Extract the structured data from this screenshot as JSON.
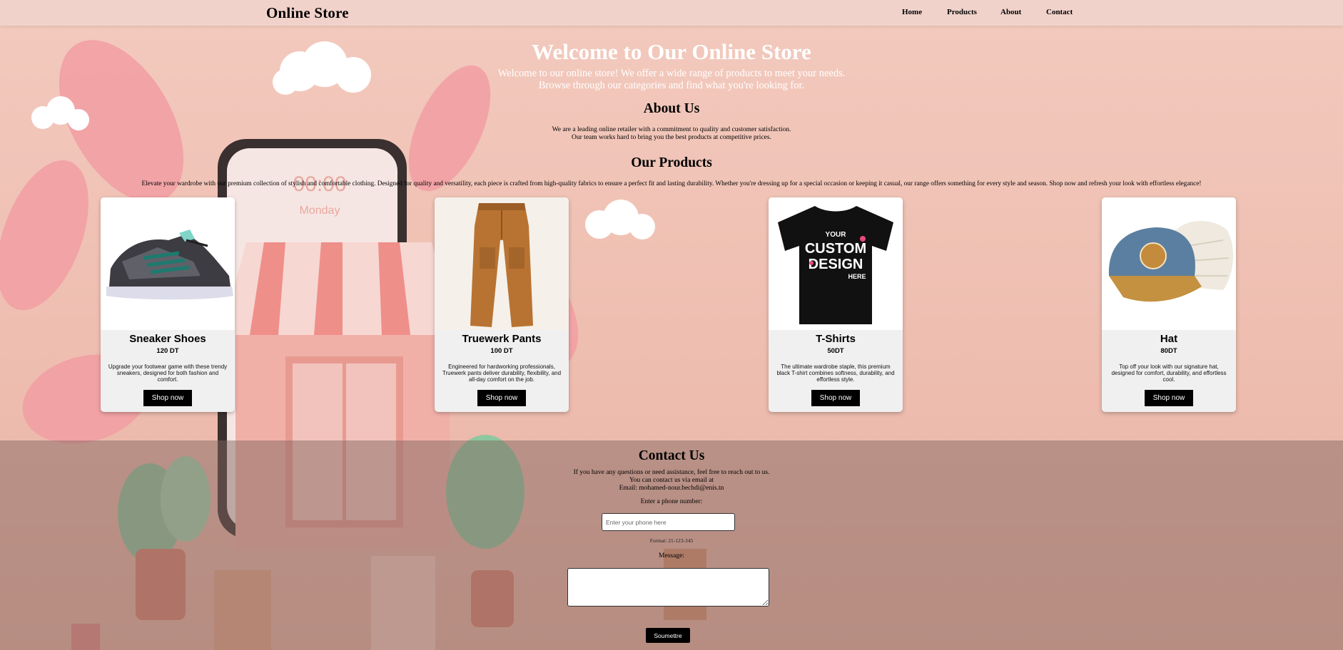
{
  "header": {
    "brand": "Online Store",
    "nav": [
      "Home",
      "Products",
      "About",
      "Contact"
    ]
  },
  "hero": {
    "title": "Welcome to Our Online Store",
    "line1": "Welcome to our online store! We offer a wide range of products to meet your needs.",
    "line2": "Browse through our categories and find what you're looking for."
  },
  "about": {
    "title": "About Us",
    "line1": "We are a leading online retailer with a commitment to quality and customer satisfaction.",
    "line2": "Our team works hard to bring you the best products at competitive prices."
  },
  "products": {
    "title": "Our Products",
    "intro": "Elevate your wardrobe with our premium collection of stylish and comfortable clothing. Designed for quality and versatility, each piece is crafted from high-quality fabrics to ensure a perfect fit and lasting durability. Whether you're dressing up for a special occasion or keeping it casual, our range offers something for every style and season. Shop now and refresh your look with effortless elegance!",
    "items": [
      {
        "name": "Sneaker Shoes",
        "price": "120 DT",
        "description": "Upgrade your footwear game with these trendy sneakers, designed for both fashion and comfort.",
        "button": "Shop now",
        "icon": "sneaker-icon"
      },
      {
        "name": "Truewerk Pants",
        "price": "100 DT",
        "description": "Engineered for hardworking professionals, Truewerk pants deliver durability, flexibility, and all-day comfort on the job.",
        "button": "Shop now",
        "icon": "pants-icon"
      },
      {
        "name": "T-Shirts",
        "price": "50DT",
        "description": "The ultimate wardrobe staple, this premium black T-shirt combines softness, durability, and effortless style.",
        "button": "Shop now",
        "icon": "tshirt-icon",
        "print_line1": "YOUR",
        "print_line2": "CUSTOM",
        "print_line3": "DESIGN",
        "print_line4": "HERE"
      },
      {
        "name": "Hat",
        "price": "80DT",
        "description": "Top off your look with our signature hat, designed for comfort, durability, and effortless cool.",
        "button": "Shop now",
        "icon": "hat-icon"
      }
    ]
  },
  "contact": {
    "title": "Contact Us",
    "line1": "If you have any questions or need assistance, feel free to reach out to us.",
    "line2": "You can contact us via email at",
    "line3": "Email: mohamed-nour.bechdi@enis.tn",
    "phone_label": "Enter a phone number:",
    "phone_placeholder": "Enter your phone here",
    "phone_format": "Format: 21-123-345",
    "message_label": "Message:",
    "submit": "Soumettre"
  },
  "background": {
    "phone_clock": "00:00",
    "phone_day": "Monday"
  },
  "colors": {
    "page_bg": "#f0c4b8",
    "header_bg": "#f0d2cc",
    "button": "#000000",
    "contact_overlay": "#82645f"
  }
}
